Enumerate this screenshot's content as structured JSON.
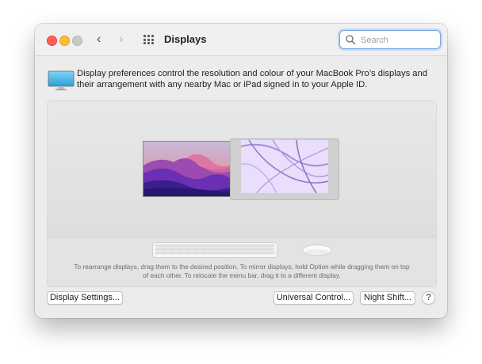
{
  "window": {
    "title": "Displays",
    "nav_back": "‹",
    "nav_forward": "›"
  },
  "search": {
    "placeholder": "Search",
    "value": ""
  },
  "info": {
    "text": "Display preferences control the resolution and colour of your MacBook Pro’s displays and their arrangement with any nearby Mac or iPad signed in to your Apple ID."
  },
  "arrangement": {
    "hint": "To rearrange displays, drag them to the desired position. To mirror displays, hold Option while dragging them on top of each other. To relocate the menu bar, drag it to a different display."
  },
  "buttons": {
    "display_settings": "Display Settings...",
    "universal_control": "Universal Control...",
    "night_shift": "Night Shift...",
    "help": "?"
  },
  "colors": {
    "close": "#ff5f57",
    "minimize": "#febc2e",
    "zoom_disabled": "#c9c9c9",
    "search_focus": "#7aa7e6",
    "monterey_purple": "#5a2fb8",
    "imac_lavender": "#e6d9fb"
  }
}
